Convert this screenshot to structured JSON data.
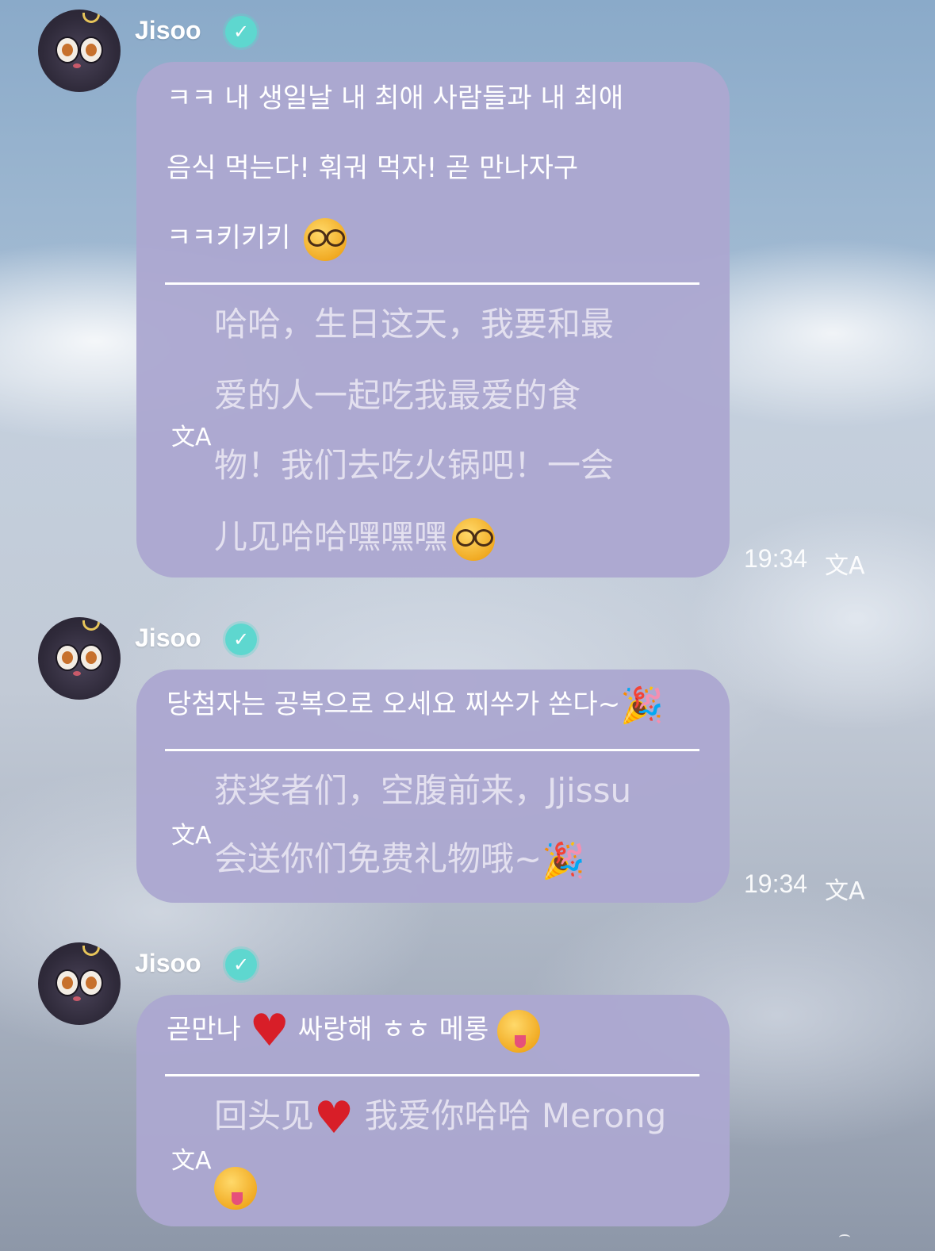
{
  "messages": [
    {
      "sender": "Jisoo",
      "korean_lines": [
        "ㅋㅋ 내 생일날 내 최애 사람들과 내 최애",
        "음식 먹는다! 훠궈 먹자! 곧 만나자구",
        "ㅋㅋ키키키"
      ],
      "chinese_lines": [
        "哈哈，生日这天，我要和最",
        "爱的人一起吃我最爱的食",
        "物！我们去吃火锅吧！一会",
        "儿见哈哈嘿嘿嘿"
      ],
      "time": "19:34"
    },
    {
      "sender": "Jisoo",
      "korean_lines": [
        "당첨자는 공복으로 오세요 찌쑤가 쏜다~"
      ],
      "chinese_lines": [
        "获奖者们，空腹前来，Jjissu",
        "会送你们免费礼物哦~"
      ],
      "time": "19:34"
    },
    {
      "sender": "Jisoo",
      "korean_parts": [
        "곧만나",
        "싸랑해 ㅎㅎ 메롱"
      ],
      "chinese_parts": [
        "回头见",
        "我爱你哈哈 Merong"
      ]
    }
  ],
  "icons": {
    "verified": "verified-badge-icon",
    "translate": "translate-icon",
    "avatar": "luna-cat-avatar",
    "translate_glyph": "文A"
  },
  "colors": {
    "bubble": "#aca8d0",
    "badge": "#5ed7cf",
    "translation_text": "#e3e0ef"
  }
}
